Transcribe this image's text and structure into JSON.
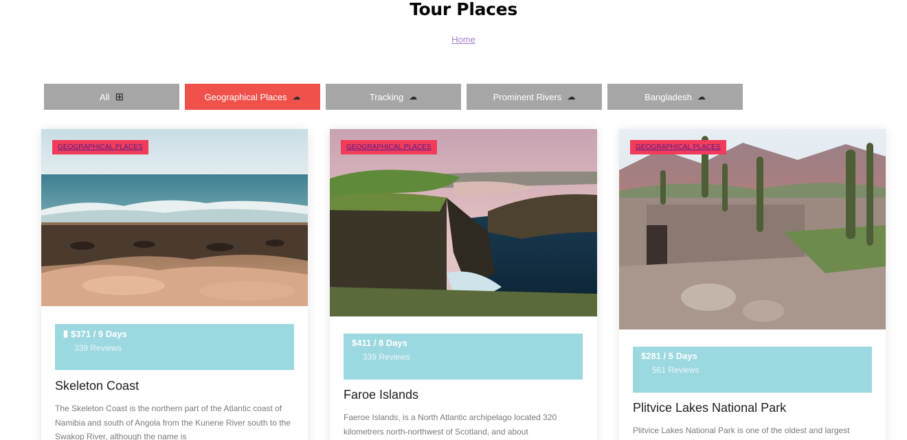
{
  "page": {
    "title": "Tour Places",
    "breadcrumb": "Home"
  },
  "filters": [
    {
      "label": "All",
      "icon": "grid-icon",
      "active": false
    },
    {
      "label": "Geographical Places",
      "icon": "cloud-icon",
      "active": true
    },
    {
      "label": "Tracking",
      "icon": "cloud-icon",
      "active": false
    },
    {
      "label": "Prominent Rivers",
      "icon": "cloud-icon",
      "active": false
    },
    {
      "label": "Bangladesh",
      "icon": "cloud-icon",
      "active": false
    }
  ],
  "cards": [
    {
      "badge": "GEOGRAPHICAL PLACES",
      "price": "$371 / 9 Days",
      "reviews": "339 Reviews",
      "title": "Skeleton Coast",
      "description": "The Skeleton Coast is the northern part of the Atlantic coast of Namibia and south of Angola from the Kunene River south to the Swakop River, although the name is",
      "image": "seals-on-beach-photo"
    },
    {
      "badge": "GEOGRAPHICAL PLACES",
      "price": "$411 / 8 Days",
      "reviews": "339 Reviews",
      "title": "Faroe Islands",
      "description": "Faeroe Islands, is a North Atlantic archipelago located 320 kilometrers north-northwest of Scotland, and about",
      "image": "cliff-lake-photo"
    },
    {
      "badge": "GEOGRAPHICAL PLACES",
      "price": "$281 / 5 Days",
      "reviews": "561 Reviews",
      "title": "Plitvice Lakes National Park",
      "description": "Plitvice Lakes National Park is one of the oldest and largest",
      "image": "stone-ruins-cactus-photo"
    }
  ],
  "colors": {
    "accent": "#f0524b",
    "filter_bg": "#a6a6a6",
    "badge": "#f23a5b",
    "price_box": "#9bd8e0"
  }
}
